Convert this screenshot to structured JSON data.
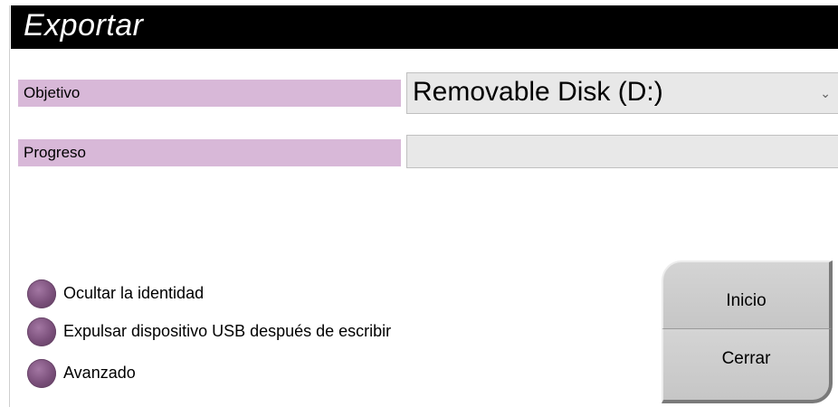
{
  "window": {
    "title": "Exportar"
  },
  "target": {
    "label": "Objetivo",
    "selected": "Removable Disk (D:)"
  },
  "progress": {
    "label": "Progreso",
    "value_percent": 0
  },
  "options": [
    {
      "label": "Ocultar la identidad",
      "icon": "radio-button-icon"
    },
    {
      "label": "Expulsar dispositivo USB después de escribir",
      "icon": "radio-button-icon"
    },
    {
      "label": "Avanzado",
      "icon": "radio-button-icon"
    }
  ],
  "buttons": {
    "start_label": "Inicio",
    "close_label": "Cerrar"
  },
  "colors": {
    "title_bar": "#000000",
    "label_bg": "#d8b8d8",
    "radio": "#7a4f7a",
    "button": "#c8c8c8",
    "field_bg": "#e8e8e8"
  }
}
